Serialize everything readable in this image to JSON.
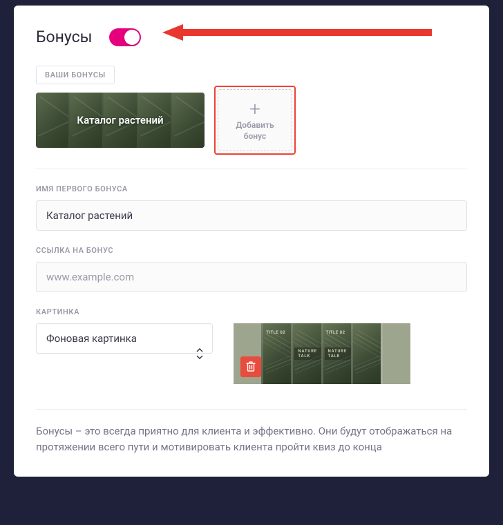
{
  "header": {
    "title": "Бонусы",
    "toggle_on": true
  },
  "tab_label": "ВАШИ БОНУСЫ",
  "bonus_card": {
    "label": "Каталог растений"
  },
  "add_bonus": {
    "line1": "Добавить",
    "line2": "бонус"
  },
  "fields": {
    "name_label": "ИМЯ ПЕРВОГО БОНУСА",
    "name_value": "Каталог растений",
    "link_label": "ССЫЛКА НА БОНУС",
    "link_placeholder": "www.example.com",
    "picture_label": "КАРТИНКА",
    "picture_select_value": "Фоновая картинка"
  },
  "preview_badges": {
    "title": "TITLE 02",
    "nature": "NATURE TALK"
  },
  "footer_text": "Бонусы – это всегда приятно для клиента и эффективно. Они будут отображаться на протяжении всего пути и мотивировать клиента пройти квиз до конца"
}
